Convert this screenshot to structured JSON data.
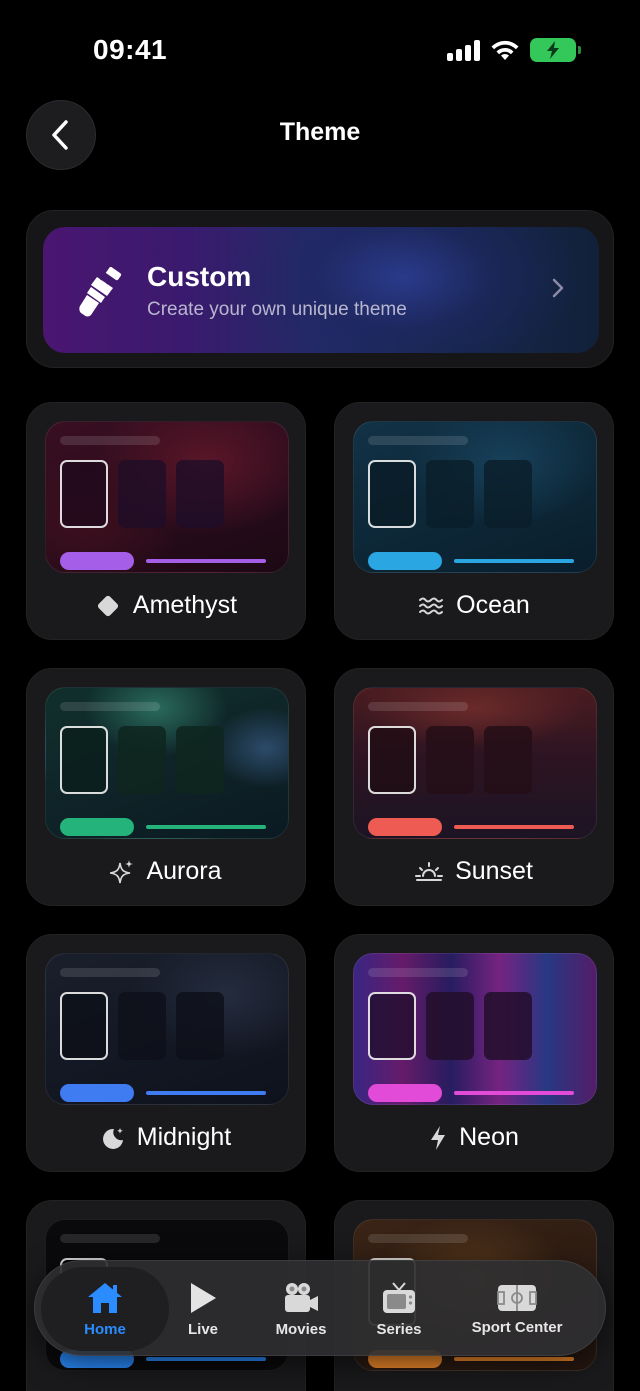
{
  "status": {
    "time": "09:41"
  },
  "header": {
    "title": "Theme"
  },
  "custom": {
    "title": "Custom",
    "subtitle": "Create your own unique theme"
  },
  "themes": [
    {
      "name": "Amethyst",
      "icon": "diamond-icon",
      "accent": "#a55ee8"
    },
    {
      "name": "Ocean",
      "icon": "waves-icon",
      "accent": "#2aa6e3"
    },
    {
      "name": "Aurora",
      "icon": "sparkles-icon",
      "accent": "#23b37b"
    },
    {
      "name": "Sunset",
      "icon": "sunset-icon",
      "accent": "#ee5b52"
    },
    {
      "name": "Midnight",
      "icon": "moon-icon",
      "accent": "#3f7cf2"
    },
    {
      "name": "Neon",
      "icon": "bolt-icon",
      "accent": "#e24ad8"
    }
  ],
  "tabbar": {
    "items": [
      {
        "label": "Home",
        "icon": "house-icon",
        "active": true
      },
      {
        "label": "Live",
        "icon": "play-icon",
        "active": false
      },
      {
        "label": "Movies",
        "icon": "video-camera-icon",
        "active": false
      },
      {
        "label": "Series",
        "icon": "tv-icon",
        "active": false
      },
      {
        "label": "Sport Center",
        "icon": "soccer-field-icon",
        "active": false
      }
    ]
  },
  "colors": {
    "active_tab": "#2a8cff",
    "battery": "#34c759"
  }
}
